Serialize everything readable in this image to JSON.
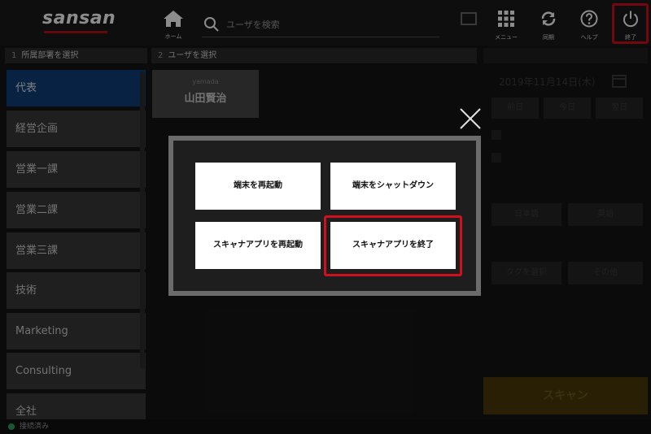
{
  "header": {
    "logo": "sansan",
    "home_label": "ホーム",
    "search_placeholder": "ユーザを検索",
    "dim_button_label": "",
    "menu_label": "メニュー",
    "sync_label": "同期",
    "help_label": "ヘルプ",
    "exit_label": "終了"
  },
  "columns": {
    "dept_num": "1",
    "dept_title": "所属部署を選択",
    "user_num": "2",
    "user_title": "ユーザを選択"
  },
  "departments": [
    {
      "label": "代表",
      "selected": true
    },
    {
      "label": "経営企画",
      "selected": false
    },
    {
      "label": "営業一課",
      "selected": false
    },
    {
      "label": "営業二課",
      "selected": false
    },
    {
      "label": "営業三課",
      "selected": false
    },
    {
      "label": "技術",
      "selected": false
    },
    {
      "label": "Marketing",
      "selected": false
    },
    {
      "label": "Consulting",
      "selected": false
    },
    {
      "label": "全社",
      "selected": false
    }
  ],
  "user": {
    "kana": "yamada",
    "name": "山田賢治"
  },
  "right_panel": {
    "date": "2019年11月14日(木)",
    "day_buttons": [
      "前日",
      "今日",
      "翌日"
    ],
    "lang_buttons": [
      "日本語",
      "英語"
    ],
    "option_buttons": [
      "タグを選択",
      "その他"
    ],
    "scan_label": "スキャン"
  },
  "status": {
    "text": "接続済み"
  },
  "modal": {
    "buttons": [
      "端末を再起動",
      "端末をシャットダウン",
      "スキャナアプリを再起動",
      "スキャナアプリを終了"
    ]
  },
  "colors": {
    "accent_red": "#d0101c",
    "selected_blue": "#0d3f7a",
    "status_green": "#2aa35a"
  }
}
